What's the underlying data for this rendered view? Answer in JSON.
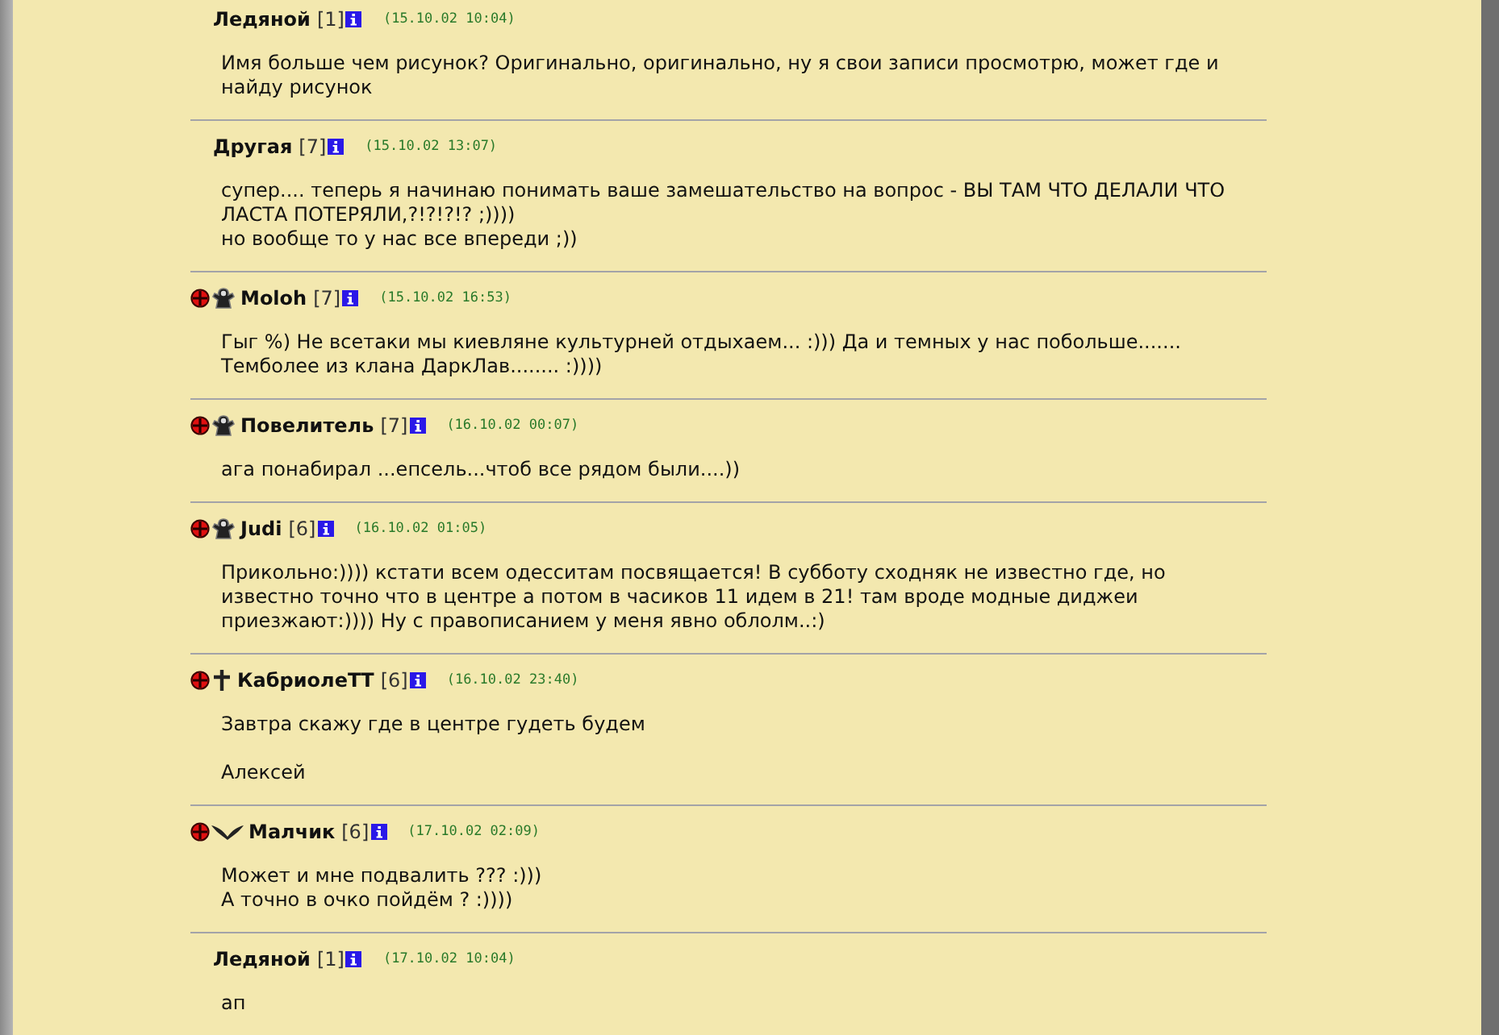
{
  "posts": [
    {
      "author": "Ледяной",
      "level": "[1]",
      "date": "(15.10.02 10:04)",
      "paragraphs": [
        [
          "Имя больше чем рисунок? Оригинально, оригинально, ну я свои записи просмотрю, может где и",
          "найду рисунок"
        ]
      ]
    },
    {
      "author": "Другая",
      "level": "[7]",
      "date": "(15.10.02 13:07)",
      "paragraphs": [
        [
          "супер.... теперь я начинаю понимать ваше замешательство на вопрос - ВЫ ТАМ ЧТО ДЕЛАЛИ ЧТО",
          "ЛАСТА ПОТЕРЯЛИ,?!?!?!? ;))))",
          "но вообще то у нас все впереди ;))"
        ]
      ]
    },
    {
      "badges": [
        {
          "kind": "clan"
        },
        {
          "kind": "figure"
        }
      ],
      "author": "Moloh",
      "level": "[7]",
      "date": "(15.10.02 16:53)",
      "paragraphs": [
        [
          "Гыг %) Не всетаки мы киевляне культурней отдыхаем... :))) Да и темных у нас побольше.......",
          "Темболее из клана ДаркЛав........ :))))"
        ]
      ]
    },
    {
      "badges": [
        {
          "kind": "clan"
        },
        {
          "kind": "figure"
        }
      ],
      "author": "Повелитель",
      "level": "[7]",
      "date": "(16.10.02 00:07)",
      "paragraphs": [
        [
          "ага понабирал ...епсель...чтоб все рядом были....))"
        ]
      ]
    },
    {
      "badges": [
        {
          "kind": "clan"
        },
        {
          "kind": "figure"
        }
      ],
      "author": "Judi",
      "level": "[6]",
      "date": "(16.10.02 01:05)",
      "paragraphs": [
        [
          "Прикольно:)))) кстати всем одесситам посвящается! В субботу сходняк не известно где, но",
          "известно точно что в центре а потом в часиков 11 идем в 21! там вроде модные диджеи",
          "приезжают:)))) Ну с правописанием у меня явно облолм..:)"
        ]
      ]
    },
    {
      "badges": [
        {
          "kind": "clan"
        },
        {
          "kind": "dagger"
        }
      ],
      "author": "КабриолеТТ",
      "level": "[6]",
      "date": "(16.10.02 23:40)",
      "paragraphs": [
        [
          "Завтра скажу где в центре гудеть будем"
        ],
        [
          "Алексей"
        ]
      ]
    },
    {
      "badges": [
        {
          "kind": "clan"
        },
        {
          "kind": "wings"
        }
      ],
      "author": "Малчик",
      "level": "[6]",
      "date": "(17.10.02 02:09)",
      "paragraphs": [
        [
          "Может и мне подвалить ??? :)))",
          "А точно в очко пойдём ? :))))"
        ]
      ]
    },
    {
      "author": "Ледяной",
      "level": "[1]",
      "date": "(17.10.02 10:04)",
      "paragraphs": [
        [
          "ап"
        ]
      ]
    }
  ]
}
